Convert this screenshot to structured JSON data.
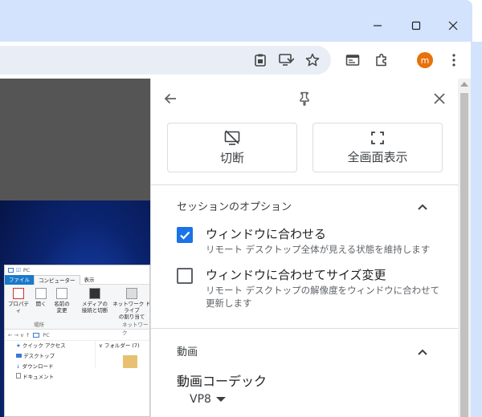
{
  "browser": {
    "window_controls": [
      "minimize",
      "maximize",
      "close"
    ],
    "toolbar_icons": [
      "clipboard-icon",
      "send-to-screen-icon",
      "bookmark-star-icon",
      "reading-list-icon",
      "extensions-icon",
      "profile-avatar",
      "menu-icon"
    ],
    "profile_initial": "m",
    "profile_color": "#e8710a"
  },
  "remote_desktop": {
    "explorer": {
      "title_path": "PC",
      "tabs": [
        "ファイル",
        "コンピューター",
        "表示"
      ],
      "ribbon_buttons": [
        "プロパティ",
        "開く",
        "名前の\n変更",
        "メディアの\n接続と切断",
        "ネットワーク ドライブ\nの割り当て"
      ],
      "ribbon_groups": [
        "場所",
        "ネットワーク"
      ],
      "address": "PC",
      "nav_items": [
        "クイック アクセス",
        "デスクトップ",
        "ダウンロード",
        "ドキュメント"
      ],
      "files_header": "フォルダー (7)"
    }
  },
  "panel": {
    "back_icon": "arrow-back-icon",
    "pin_icon": "pin-icon",
    "close_icon": "close-icon",
    "disconnect_label": "切断",
    "fullscreen_label": "全画面表示",
    "session_options_title": "セッションのオプション",
    "option_fit_window": {
      "label": "ウィンドウに合わせる",
      "description": "リモート デスクトップ全体が見える状態を維持します",
      "checked": true
    },
    "option_fit_resize": {
      "label": "ウィンドウに合わせてサイズ変更",
      "description": "リモート デスクトップの解像度をウィンドウに合わせて更新します",
      "checked": false
    },
    "video_title": "動画",
    "codec_label": "動画コーデック",
    "codec_value": "VP8",
    "accent_color": "#1a73e8"
  }
}
